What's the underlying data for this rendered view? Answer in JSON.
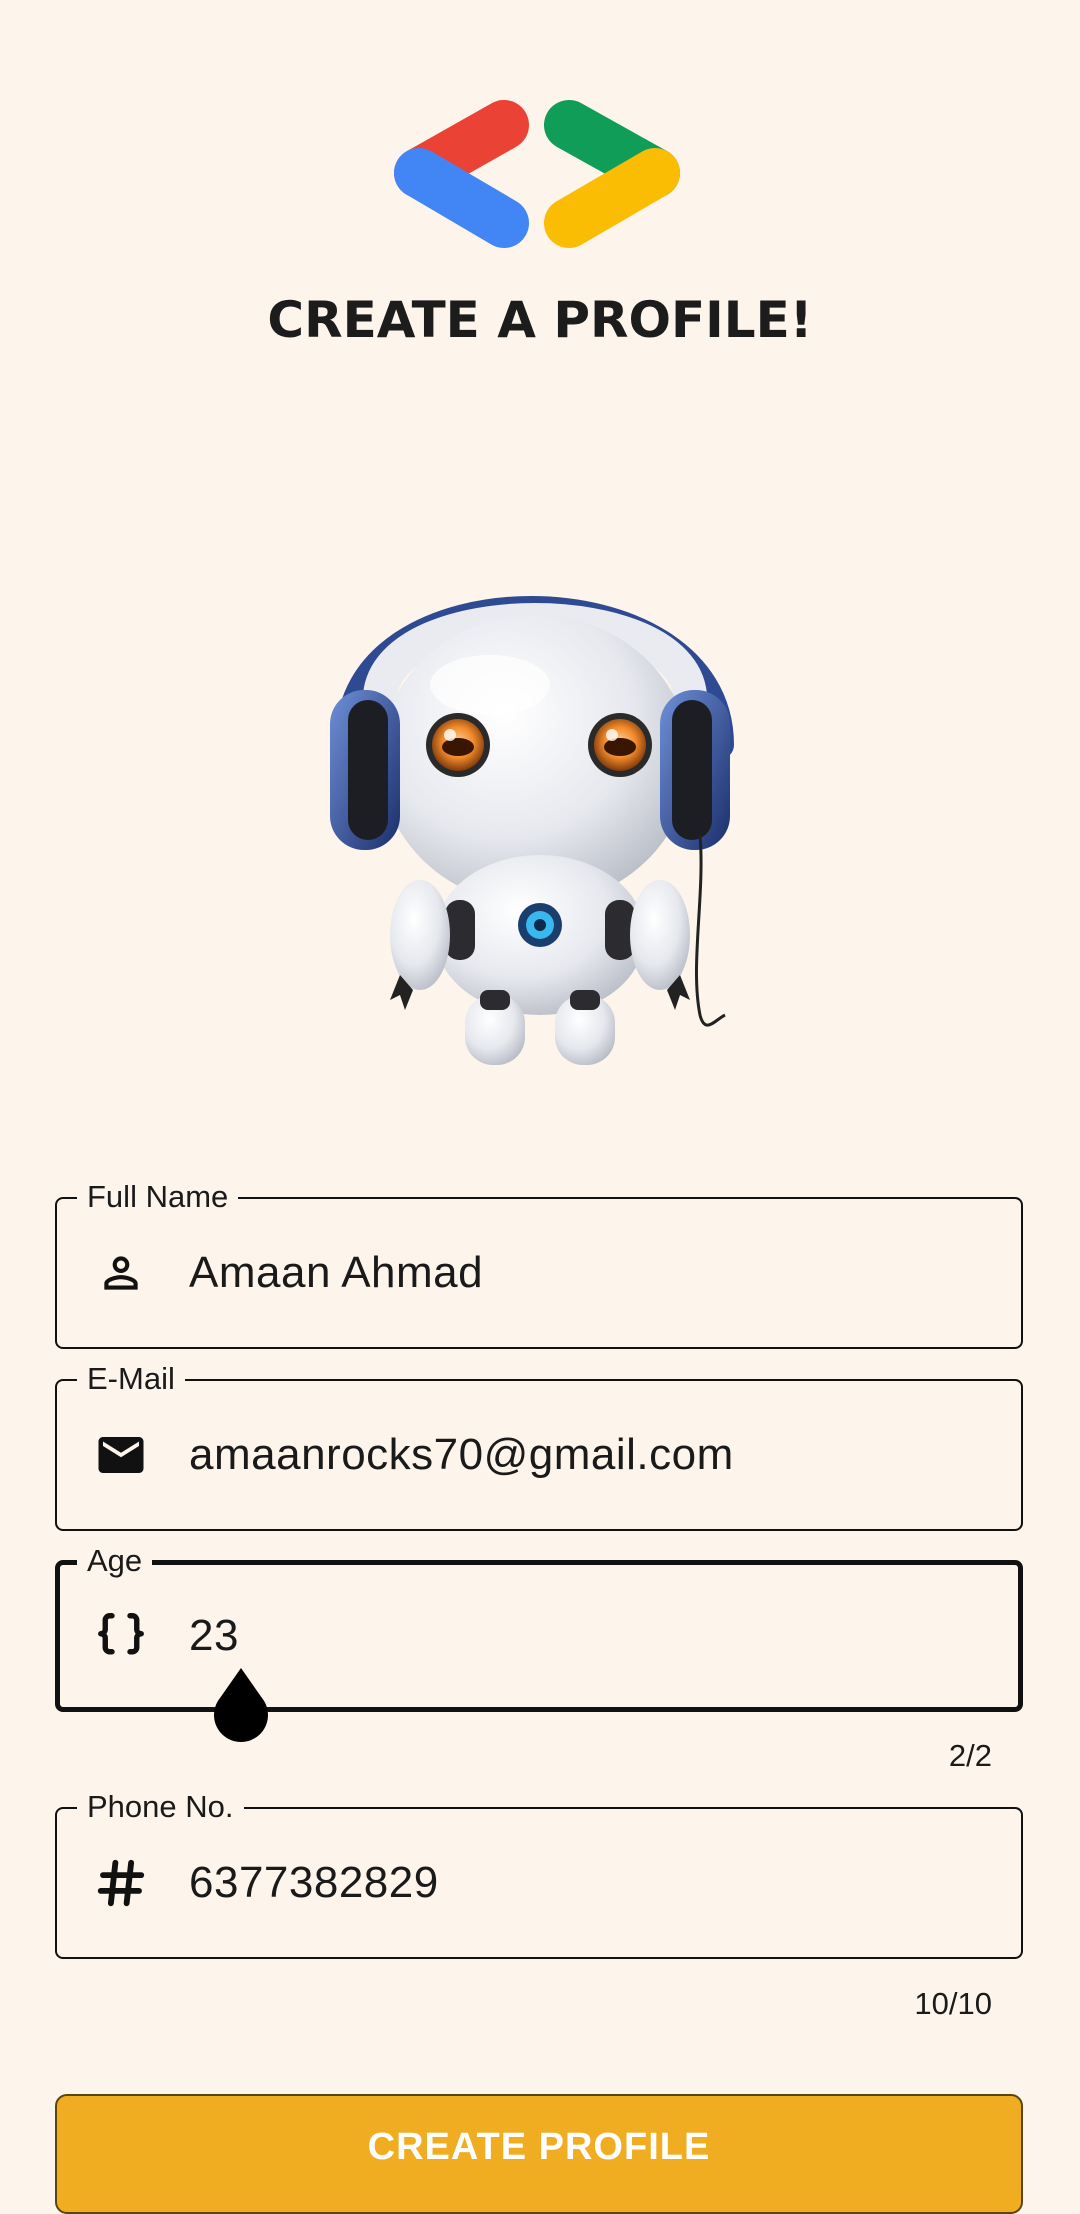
{
  "header": {
    "title": "CREATE A PROFILE!"
  },
  "colors": {
    "background": "#fdf4ec",
    "logo_red": "#ea4335",
    "logo_blue": "#4285f4",
    "logo_green": "#0f9d58",
    "logo_yellow": "#fbbc04",
    "button": "#f0ad22"
  },
  "form": {
    "full_name": {
      "label": "Full Name",
      "value": "Amaan Ahmad",
      "icon": "person-icon"
    },
    "email": {
      "label": "E-Mail",
      "value": "amaanrocks70@gmail.com",
      "icon": "mail-icon"
    },
    "age": {
      "label": "Age",
      "value": "23",
      "icon": "braces-icon",
      "counter": "2/2"
    },
    "phone": {
      "label": "Phone No.",
      "value": "6377382829",
      "icon": "hash-icon",
      "counter": "10/10"
    }
  },
  "submit": {
    "label": "CREATE PROFILE"
  }
}
